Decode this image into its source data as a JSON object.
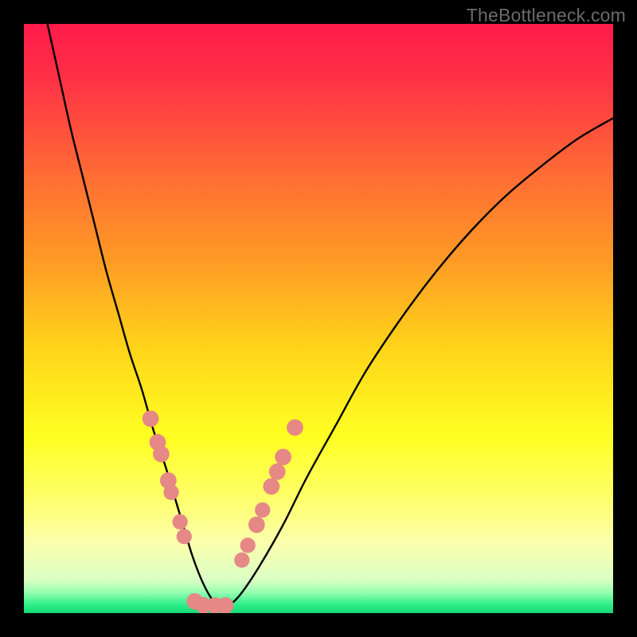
{
  "watermark": "TheBottleneck.com",
  "gradient": {
    "stops": [
      {
        "offset": 0.0,
        "color": "#ff1a4a"
      },
      {
        "offset": 0.1,
        "color": "#ff3345"
      },
      {
        "offset": 0.25,
        "color": "#ff6a35"
      },
      {
        "offset": 0.4,
        "color": "#ff9a25"
      },
      {
        "offset": 0.55,
        "color": "#ffd41a"
      },
      {
        "offset": 0.7,
        "color": "#ffff22"
      },
      {
        "offset": 0.8,
        "color": "#feff66"
      },
      {
        "offset": 0.88,
        "color": "#fcffad"
      },
      {
        "offset": 0.945,
        "color": "#d9ffc4"
      },
      {
        "offset": 0.965,
        "color": "#95ffb0"
      },
      {
        "offset": 0.985,
        "color": "#30f08a"
      },
      {
        "offset": 1.0,
        "color": "#14d874"
      }
    ]
  },
  "chart_data": {
    "type": "line",
    "title": "",
    "xlabel": "",
    "ylabel": "",
    "xlim": [
      0,
      100
    ],
    "ylim": [
      0,
      100
    ],
    "series": [
      {
        "name": "bottleneck-curve",
        "x": [
          4,
          6,
          8,
          10,
          12,
          14,
          16,
          18,
          20,
          22,
          24,
          25.5,
          27,
          28.5,
          30,
          31.5,
          33,
          35,
          37,
          40,
          44,
          48,
          53,
          58,
          64,
          70,
          76,
          82,
          88,
          94,
          100
        ],
        "values": [
          100,
          91,
          82,
          74,
          66,
          58,
          51,
          44,
          38,
          31,
          25,
          20,
          15,
          10,
          6,
          3,
          1.2,
          1.5,
          3.5,
          8,
          15,
          23,
          32,
          41,
          50,
          58,
          65,
          71,
          76,
          80.5,
          84
        ]
      }
    ],
    "markers": {
      "name": "highlight-points",
      "color": "#e58886",
      "points": [
        {
          "x": 21.5,
          "y": 33.0,
          "r": 1.4
        },
        {
          "x": 22.7,
          "y": 29.0,
          "r": 1.4
        },
        {
          "x": 23.3,
          "y": 27.0,
          "r": 1.4
        },
        {
          "x": 24.5,
          "y": 22.5,
          "r": 1.4
        },
        {
          "x": 25.0,
          "y": 20.5,
          "r": 1.3
        },
        {
          "x": 26.5,
          "y": 15.5,
          "r": 1.3
        },
        {
          "x": 27.2,
          "y": 13.0,
          "r": 1.3
        },
        {
          "x": 29.0,
          "y": 2.0,
          "r": 1.4
        },
        {
          "x": 30.5,
          "y": 1.3,
          "r": 1.4
        },
        {
          "x": 32.5,
          "y": 1.3,
          "r": 1.4
        },
        {
          "x": 34.2,
          "y": 1.3,
          "r": 1.4
        },
        {
          "x": 37.0,
          "y": 9.0,
          "r": 1.3
        },
        {
          "x": 38.0,
          "y": 11.5,
          "r": 1.3
        },
        {
          "x": 39.5,
          "y": 15.0,
          "r": 1.4
        },
        {
          "x": 40.5,
          "y": 17.5,
          "r": 1.3
        },
        {
          "x": 42.0,
          "y": 21.5,
          "r": 1.4
        },
        {
          "x": 43.0,
          "y": 24.0,
          "r": 1.4
        },
        {
          "x": 44.0,
          "y": 26.5,
          "r": 1.4
        },
        {
          "x": 46.0,
          "y": 31.5,
          "r": 1.4
        }
      ]
    }
  }
}
